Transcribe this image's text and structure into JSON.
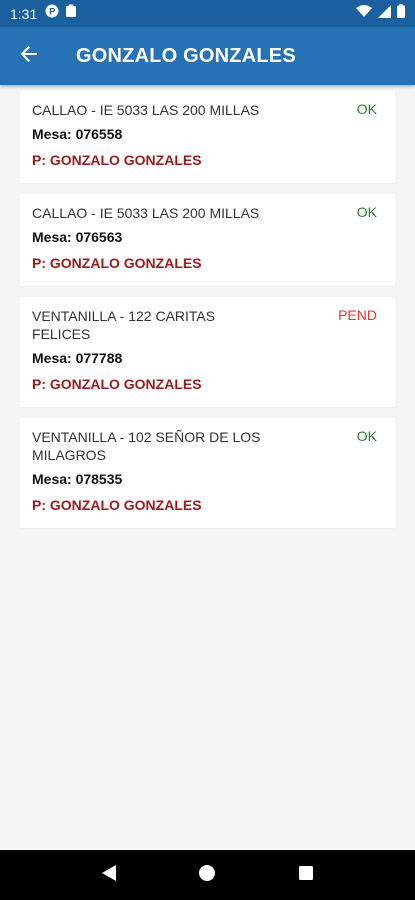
{
  "status_bar": {
    "time": "1:31",
    "icons": [
      "parking-notification-icon",
      "clipboard-icon",
      "wifi-icon",
      "signal-icon",
      "battery-icon"
    ]
  },
  "app_bar": {
    "title": "GONZALO GONZALES",
    "back_icon": "arrow-left-icon",
    "color": "#2672b5"
  },
  "items": [
    {
      "place": "CALLAO - IE 5033 LAS 200 MILLAS",
      "mesa": "Mesa: 076558",
      "person": "P: GONZALO GONZALES",
      "status": "OK"
    },
    {
      "place": "CALLAO - IE 5033 LAS 200 MILLAS",
      "mesa": "Mesa: 076563",
      "person": "P: GONZALO GONZALES",
      "status": "OK"
    },
    {
      "place": "VENTANILLA - 122 CARITAS FELICES",
      "mesa": "Mesa: 077788",
      "person": "P: GONZALO GONZALES",
      "status": "PEND"
    },
    {
      "place": "VENTANILLA - 102 SEÑOR DE LOS MILAGROS",
      "mesa": "Mesa: 078535",
      "person": "P: GONZALO GONZALES",
      "status": "OK"
    }
  ],
  "colors": {
    "ok": "#2e7d32",
    "pend": "#e53935",
    "person": "#9a1c1c"
  },
  "nav": {
    "icons": [
      "back-triangle-icon",
      "home-circle-icon",
      "recents-square-icon"
    ]
  }
}
